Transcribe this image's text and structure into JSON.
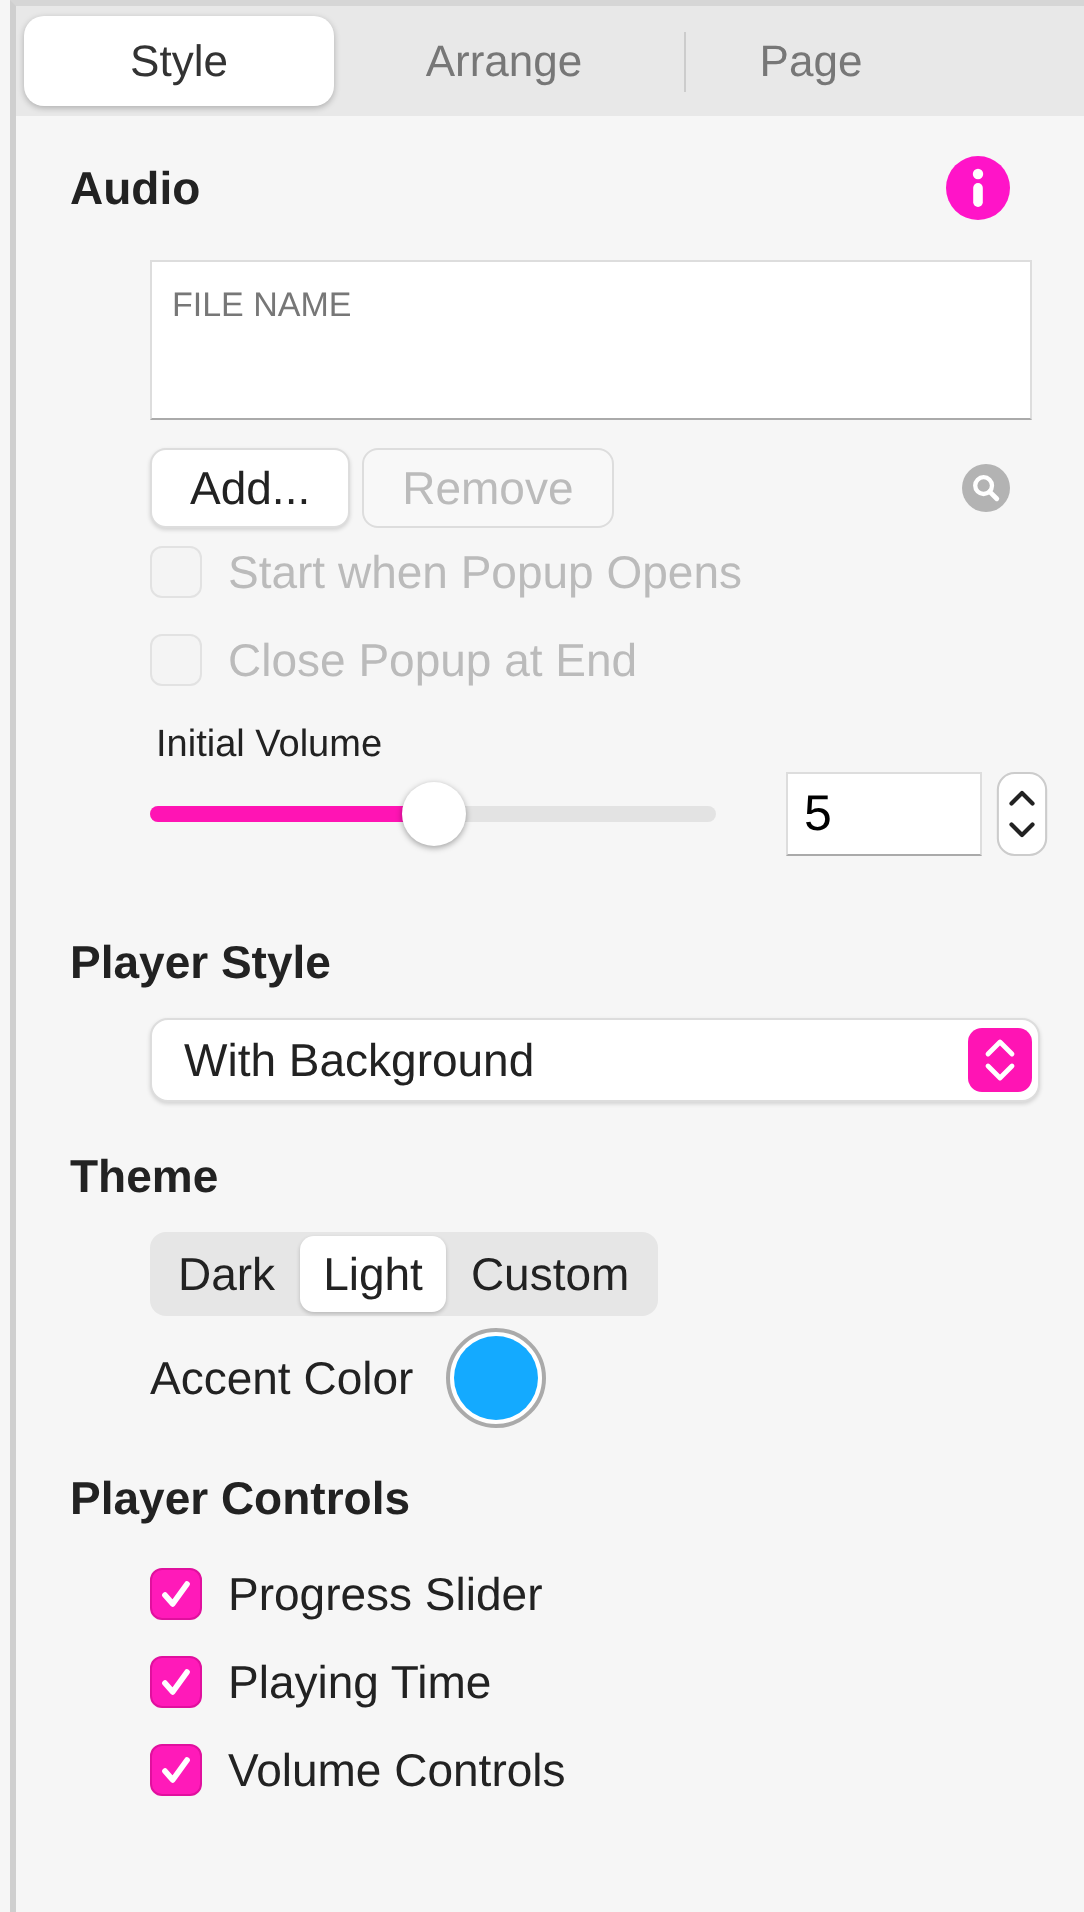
{
  "tabs": [
    {
      "label": "Style",
      "selected": true
    },
    {
      "label": "Arrange",
      "selected": false
    },
    {
      "label": "Page",
      "selected": false
    }
  ],
  "audio": {
    "title": "Audio",
    "file_list": {
      "placeholder": "FILE NAME"
    },
    "buttons": [
      {
        "label": "Add...",
        "disabled": false
      },
      {
        "label": "Remove",
        "disabled": true
      }
    ],
    "options": [
      {
        "label": "Start when Popup Opens",
        "checked": false,
        "disabled": true
      },
      {
        "label": "Close Popup at End",
        "checked": false,
        "disabled": true
      }
    ],
    "volume": {
      "label": "Initial Volume",
      "level": 0.5,
      "value": "5"
    }
  },
  "player_style": {
    "title": "Player Style",
    "value": "With Background"
  },
  "theme": {
    "title": "Theme",
    "options": [
      {
        "label": "Dark",
        "selected": false
      },
      {
        "label": "Light",
        "selected": true
      },
      {
        "label": "Custom",
        "selected": false
      }
    ],
    "accent": {
      "label": "Accent Color",
      "color": "#14aaff"
    }
  },
  "player_controls": {
    "title": "Player Controls",
    "items": [
      {
        "label": "Progress Slider",
        "checked": true
      },
      {
        "label": "Playing Time",
        "checked": true
      },
      {
        "label": "Volume Controls",
        "checked": true
      }
    ]
  }
}
